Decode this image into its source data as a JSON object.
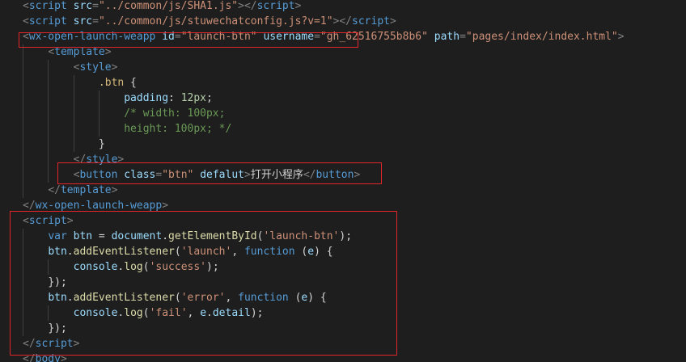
{
  "lines": [
    {
      "segs": [
        {
          "c": "punct",
          "t": "<"
        },
        {
          "c": "tag",
          "t": "script"
        },
        {
          "c": "ws",
          "t": " "
        },
        {
          "c": "attr",
          "t": "src"
        },
        {
          "c": "punct",
          "t": "="
        },
        {
          "c": "str",
          "t": "\"../common/js/SHA1.js\""
        },
        {
          "c": "punct",
          "t": "></"
        },
        {
          "c": "tag",
          "t": "script"
        },
        {
          "c": "punct",
          "t": ">"
        }
      ]
    },
    {
      "segs": [
        {
          "c": "punct",
          "t": "<"
        },
        {
          "c": "tag",
          "t": "script"
        },
        {
          "c": "ws",
          "t": " "
        },
        {
          "c": "attr",
          "t": "src"
        },
        {
          "c": "punct",
          "t": "="
        },
        {
          "c": "str",
          "t": "\"../common/js/stuwechatconfig.js?v=1\""
        },
        {
          "c": "punct",
          "t": "></"
        },
        {
          "c": "tag",
          "t": "script"
        },
        {
          "c": "punct",
          "t": ">"
        }
      ]
    },
    {
      "segs": [
        {
          "c": "punct",
          "t": "<"
        },
        {
          "c": "tag",
          "t": "wx-open-launch-weapp"
        },
        {
          "c": "ws",
          "t": " "
        },
        {
          "c": "attr",
          "t": "id"
        },
        {
          "c": "punct",
          "t": "="
        },
        {
          "c": "str",
          "t": "\"launch-btn\""
        },
        {
          "c": "ws",
          "t": " "
        },
        {
          "c": "attr",
          "t": "username"
        },
        {
          "c": "punct",
          "t": "="
        },
        {
          "c": "str",
          "t": "\"gh_62516755b8b6\""
        },
        {
          "c": "ws",
          "t": " "
        },
        {
          "c": "attr",
          "t": "path"
        },
        {
          "c": "punct",
          "t": "="
        },
        {
          "c": "str",
          "t": "\"pages/index/index.html\""
        },
        {
          "c": "punct",
          "t": ">"
        }
      ]
    },
    {
      "segs": [
        {
          "c": "ws",
          "t": "    "
        },
        {
          "c": "punct",
          "t": "<"
        },
        {
          "c": "tag",
          "t": "template"
        },
        {
          "c": "punct",
          "t": ">"
        }
      ]
    },
    {
      "segs": [
        {
          "c": "ws",
          "t": "        "
        },
        {
          "c": "punct",
          "t": "<"
        },
        {
          "c": "tag",
          "t": "style"
        },
        {
          "c": "punct",
          "t": ">"
        }
      ]
    },
    {
      "segs": [
        {
          "c": "ws",
          "t": "            "
        },
        {
          "c": "sel",
          "t": ".btn"
        },
        {
          "c": "txt",
          "t": " {"
        }
      ]
    },
    {
      "segs": [
        {
          "c": "ws",
          "t": "                "
        },
        {
          "c": "prop",
          "t": "padding"
        },
        {
          "c": "txt",
          "t": ": "
        },
        {
          "c": "num",
          "t": "12px"
        },
        {
          "c": "txt",
          "t": ";"
        }
      ]
    },
    {
      "segs": [
        {
          "c": "ws",
          "t": "                "
        },
        {
          "c": "cmt",
          "t": "/* width: 100px;"
        }
      ]
    },
    {
      "segs": [
        {
          "c": "ws",
          "t": "                "
        },
        {
          "c": "cmt",
          "t": "height: 100px; */"
        }
      ]
    },
    {
      "segs": [
        {
          "c": "ws",
          "t": "            "
        },
        {
          "c": "txt",
          "t": "}"
        }
      ]
    },
    {
      "segs": [
        {
          "c": "ws",
          "t": "        "
        },
        {
          "c": "punct",
          "t": "</"
        },
        {
          "c": "tag",
          "t": "style"
        },
        {
          "c": "punct",
          "t": ">"
        }
      ]
    },
    {
      "segs": [
        {
          "c": "ws",
          "t": "        "
        },
        {
          "c": "punct",
          "t": "<"
        },
        {
          "c": "tag",
          "t": "button"
        },
        {
          "c": "ws",
          "t": " "
        },
        {
          "c": "attr",
          "t": "class"
        },
        {
          "c": "punct",
          "t": "="
        },
        {
          "c": "str",
          "t": "\"btn\""
        },
        {
          "c": "ws",
          "t": " "
        },
        {
          "c": "attr",
          "t": "defalut"
        },
        {
          "c": "punct",
          "t": ">"
        },
        {
          "c": "txt",
          "t": "打开小程序"
        },
        {
          "c": "punct",
          "t": "</"
        },
        {
          "c": "tag",
          "t": "button"
        },
        {
          "c": "punct",
          "t": ">"
        }
      ]
    },
    {
      "segs": [
        {
          "c": "ws",
          "t": "    "
        },
        {
          "c": "punct",
          "t": "</"
        },
        {
          "c": "tag",
          "t": "template"
        },
        {
          "c": "punct",
          "t": ">"
        }
      ]
    },
    {
      "segs": [
        {
          "c": "punct",
          "t": "</"
        },
        {
          "c": "tag",
          "t": "wx-open-launch-weapp"
        },
        {
          "c": "punct",
          "t": ">"
        }
      ]
    },
    {
      "segs": [
        {
          "c": "punct",
          "t": "<"
        },
        {
          "c": "tag",
          "t": "script"
        },
        {
          "c": "punct",
          "t": ">"
        }
      ]
    },
    {
      "segs": [
        {
          "c": "ws",
          "t": "    "
        },
        {
          "c": "kw",
          "t": "var"
        },
        {
          "c": "ws",
          "t": " "
        },
        {
          "c": "var",
          "t": "btn"
        },
        {
          "c": "txt",
          "t": " = "
        },
        {
          "c": "var",
          "t": "document"
        },
        {
          "c": "txt",
          "t": "."
        },
        {
          "c": "fn",
          "t": "getElementById"
        },
        {
          "c": "txt",
          "t": "("
        },
        {
          "c": "str",
          "t": "'launch-btn'"
        },
        {
          "c": "txt",
          "t": ");"
        }
      ]
    },
    {
      "segs": [
        {
          "c": "ws",
          "t": "    "
        },
        {
          "c": "var",
          "t": "btn"
        },
        {
          "c": "txt",
          "t": "."
        },
        {
          "c": "fn",
          "t": "addEventListener"
        },
        {
          "c": "txt",
          "t": "("
        },
        {
          "c": "str",
          "t": "'launch'"
        },
        {
          "c": "txt",
          "t": ", "
        },
        {
          "c": "kw",
          "t": "function"
        },
        {
          "c": "txt",
          "t": " ("
        },
        {
          "c": "var",
          "t": "e"
        },
        {
          "c": "txt",
          "t": ") {"
        }
      ]
    },
    {
      "segs": [
        {
          "c": "ws",
          "t": "        "
        },
        {
          "c": "var",
          "t": "console"
        },
        {
          "c": "txt",
          "t": "."
        },
        {
          "c": "fn",
          "t": "log"
        },
        {
          "c": "txt",
          "t": "("
        },
        {
          "c": "str",
          "t": "'success'"
        },
        {
          "c": "txt",
          "t": ");"
        }
      ]
    },
    {
      "segs": [
        {
          "c": "ws",
          "t": "    "
        },
        {
          "c": "txt",
          "t": "});"
        }
      ]
    },
    {
      "segs": [
        {
          "c": "ws",
          "t": "    "
        },
        {
          "c": "var",
          "t": "btn"
        },
        {
          "c": "txt",
          "t": "."
        },
        {
          "c": "fn",
          "t": "addEventListener"
        },
        {
          "c": "txt",
          "t": "("
        },
        {
          "c": "str",
          "t": "'error'"
        },
        {
          "c": "txt",
          "t": ", "
        },
        {
          "c": "kw",
          "t": "function"
        },
        {
          "c": "txt",
          "t": " ("
        },
        {
          "c": "var",
          "t": "e"
        },
        {
          "c": "txt",
          "t": ") {"
        }
      ]
    },
    {
      "segs": [
        {
          "c": "ws",
          "t": "        "
        },
        {
          "c": "var",
          "t": "console"
        },
        {
          "c": "txt",
          "t": "."
        },
        {
          "c": "fn",
          "t": "log"
        },
        {
          "c": "txt",
          "t": "("
        },
        {
          "c": "str",
          "t": "'fail'"
        },
        {
          "c": "txt",
          "t": ", "
        },
        {
          "c": "var",
          "t": "e"
        },
        {
          "c": "txt",
          "t": "."
        },
        {
          "c": "var",
          "t": "detail"
        },
        {
          "c": "txt",
          "t": ");"
        }
      ]
    },
    {
      "segs": [
        {
          "c": "ws",
          "t": "    "
        },
        {
          "c": "txt",
          "t": "});"
        }
      ]
    },
    {
      "segs": [
        {
          "c": "punct",
          "t": "</"
        },
        {
          "c": "tag",
          "t": "script"
        },
        {
          "c": "punct",
          "t": ">"
        }
      ]
    },
    {
      "segs": [
        {
          "c": "punct",
          "t": "</"
        },
        {
          "c": "tag",
          "t": "body"
        },
        {
          "c": "punct",
          "t": ">"
        }
      ]
    }
  ],
  "colors": {
    "background": "#1e1e1e",
    "highlight_box": "#e0262a"
  }
}
